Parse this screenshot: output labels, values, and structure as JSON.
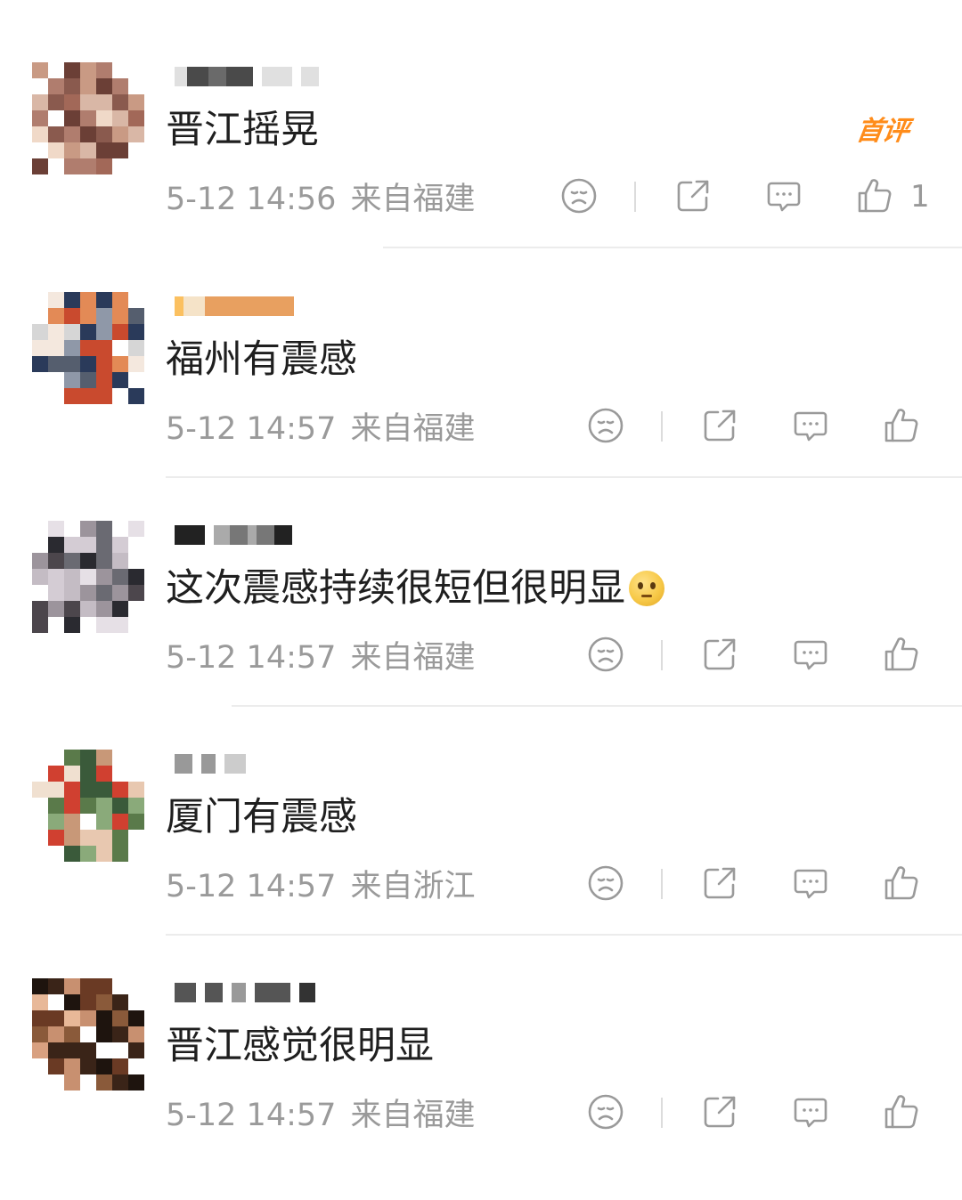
{
  "first_comment_badge": "首评",
  "comments": [
    {
      "text": "晋江摇晃",
      "time": "5-12 14:56",
      "location": "来自福建",
      "like_count": "1"
    },
    {
      "text": "福州有震感",
      "time": "5-12 14:57",
      "location": "来自福建",
      "like_count": ""
    },
    {
      "text": "这次震感持续很短但很明显",
      "time": "5-12 14:57",
      "location": "来自福建",
      "like_count": "",
      "emoji": "thinking-face-emoji"
    },
    {
      "text": "厦门有震感",
      "time": "5-12 14:57",
      "location": "来自浙江",
      "like_count": ""
    },
    {
      "text": "晋江感觉很明显",
      "time": "5-12 14:57",
      "location": "来自福建",
      "like_count": ""
    }
  ],
  "icons": {
    "dislike": "frown-face-icon",
    "share": "share-icon",
    "reply": "comment-bubble-icon",
    "like": "thumbs-up-icon"
  },
  "colors": {
    "badge": "#ff8c1a",
    "meta_text": "#9a9a9a",
    "icon": "#9a9a9a",
    "divider": "#ececec"
  }
}
